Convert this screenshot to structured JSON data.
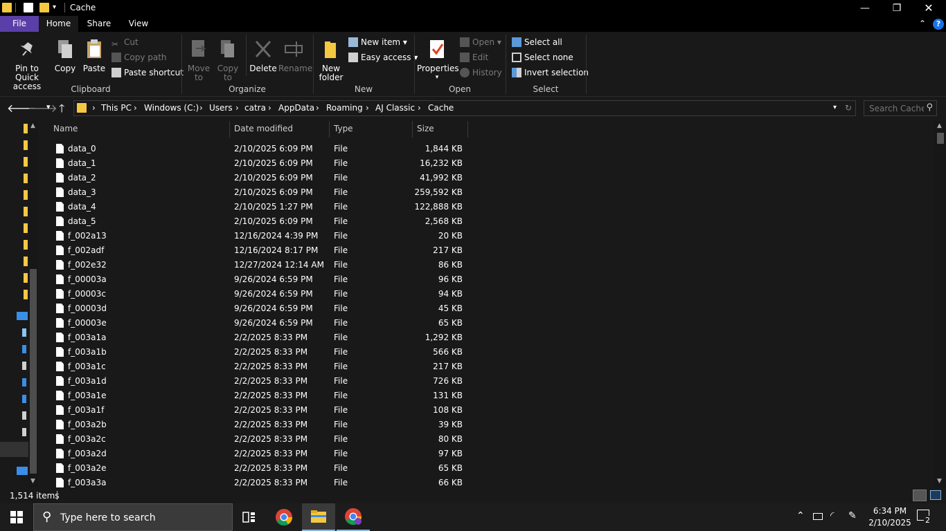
{
  "window": {
    "title": "Cache"
  },
  "ribbon_tabs": [
    "File",
    "Home",
    "Share",
    "View"
  ],
  "ribbon": {
    "clipboard": {
      "pin_label1": "Pin to Quick",
      "pin_label2": "access",
      "copy_label": "Copy",
      "paste_label": "Paste",
      "cut_label": "Cut",
      "copy_path_label": "Copy path",
      "paste_shortcut_label": "Paste shortcut",
      "group_label": "Clipboard"
    },
    "organize": {
      "move_label1": "Move",
      "move_label2": "to",
      "copyto_label1": "Copy",
      "copyto_label2": "to",
      "delete_label": "Delete",
      "rename_label": "Rename",
      "group_label": "Organize"
    },
    "new": {
      "folder_label1": "New",
      "folder_label2": "folder",
      "new_item_label": "New item",
      "easy_access_label": "Easy access",
      "group_label": "New"
    },
    "open": {
      "properties_label": "Properties",
      "open_label": "Open",
      "edit_label": "Edit",
      "history_label": "History",
      "group_label": "Open"
    },
    "select": {
      "select_all_label": "Select all",
      "select_none_label": "Select none",
      "invert_label": "Invert selection",
      "group_label": "Select"
    }
  },
  "address": {
    "crumbs": [
      "This PC",
      "Windows (C:)",
      "Users",
      "catra",
      "AppData",
      "Roaming",
      "AJ Classic",
      "Cache"
    ],
    "search_placeholder": "Search Cache"
  },
  "columns": {
    "name": "Name",
    "date": "Date modified",
    "type": "Type",
    "size": "Size"
  },
  "files": [
    {
      "name": "data_0",
      "date": "2/10/2025 6:09 PM",
      "type": "File",
      "size": "1,844 KB"
    },
    {
      "name": "data_1",
      "date": "2/10/2025 6:09 PM",
      "type": "File",
      "size": "16,232 KB"
    },
    {
      "name": "data_2",
      "date": "2/10/2025 6:09 PM",
      "type": "File",
      "size": "41,992 KB"
    },
    {
      "name": "data_3",
      "date": "2/10/2025 6:09 PM",
      "type": "File",
      "size": "259,592 KB"
    },
    {
      "name": "data_4",
      "date": "2/10/2025 1:27 PM",
      "type": "File",
      "size": "122,888 KB"
    },
    {
      "name": "data_5",
      "date": "2/10/2025 6:09 PM",
      "type": "File",
      "size": "2,568 KB"
    },
    {
      "name": "f_002a13",
      "date": "12/16/2024 4:39 PM",
      "type": "File",
      "size": "20 KB"
    },
    {
      "name": "f_002adf",
      "date": "12/16/2024 8:17 PM",
      "type": "File",
      "size": "217 KB"
    },
    {
      "name": "f_002e32",
      "date": "12/27/2024 12:14 AM",
      "type": "File",
      "size": "86 KB"
    },
    {
      "name": "f_00003a",
      "date": "9/26/2024 6:59 PM",
      "type": "File",
      "size": "96 KB"
    },
    {
      "name": "f_00003c",
      "date": "9/26/2024 6:59 PM",
      "type": "File",
      "size": "94 KB"
    },
    {
      "name": "f_00003d",
      "date": "9/26/2024 6:59 PM",
      "type": "File",
      "size": "45 KB"
    },
    {
      "name": "f_00003e",
      "date": "9/26/2024 6:59 PM",
      "type": "File",
      "size": "65 KB"
    },
    {
      "name": "f_003a1a",
      "date": "2/2/2025 8:33 PM",
      "type": "File",
      "size": "1,292 KB"
    },
    {
      "name": "f_003a1b",
      "date": "2/2/2025 8:33 PM",
      "type": "File",
      "size": "566 KB"
    },
    {
      "name": "f_003a1c",
      "date": "2/2/2025 8:33 PM",
      "type": "File",
      "size": "217 KB"
    },
    {
      "name": "f_003a1d",
      "date": "2/2/2025 8:33 PM",
      "type": "File",
      "size": "726 KB"
    },
    {
      "name": "f_003a1e",
      "date": "2/2/2025 8:33 PM",
      "type": "File",
      "size": "131 KB"
    },
    {
      "name": "f_003a1f",
      "date": "2/2/2025 8:33 PM",
      "type": "File",
      "size": "108 KB"
    },
    {
      "name": "f_003a2b",
      "date": "2/2/2025 8:33 PM",
      "type": "File",
      "size": "39 KB"
    },
    {
      "name": "f_003a2c",
      "date": "2/2/2025 8:33 PM",
      "type": "File",
      "size": "80 KB"
    },
    {
      "name": "f_003a2d",
      "date": "2/2/2025 8:33 PM",
      "type": "File",
      "size": "97 KB"
    },
    {
      "name": "f_003a2e",
      "date": "2/2/2025 8:33 PM",
      "type": "File",
      "size": "65 KB"
    },
    {
      "name": "f_003a3a",
      "date": "2/2/2025 8:33 PM",
      "type": "File",
      "size": "66 KB"
    }
  ],
  "status": {
    "item_count": "1,514 items"
  },
  "taskbar": {
    "search_placeholder": "Type here to search",
    "time": "6:34 PM",
    "date": "2/10/2025",
    "notification_count": "2"
  },
  "colors": {
    "accent_file_tab": "#5b3fa8",
    "folder": "#f5c842",
    "background": "#191919"
  }
}
